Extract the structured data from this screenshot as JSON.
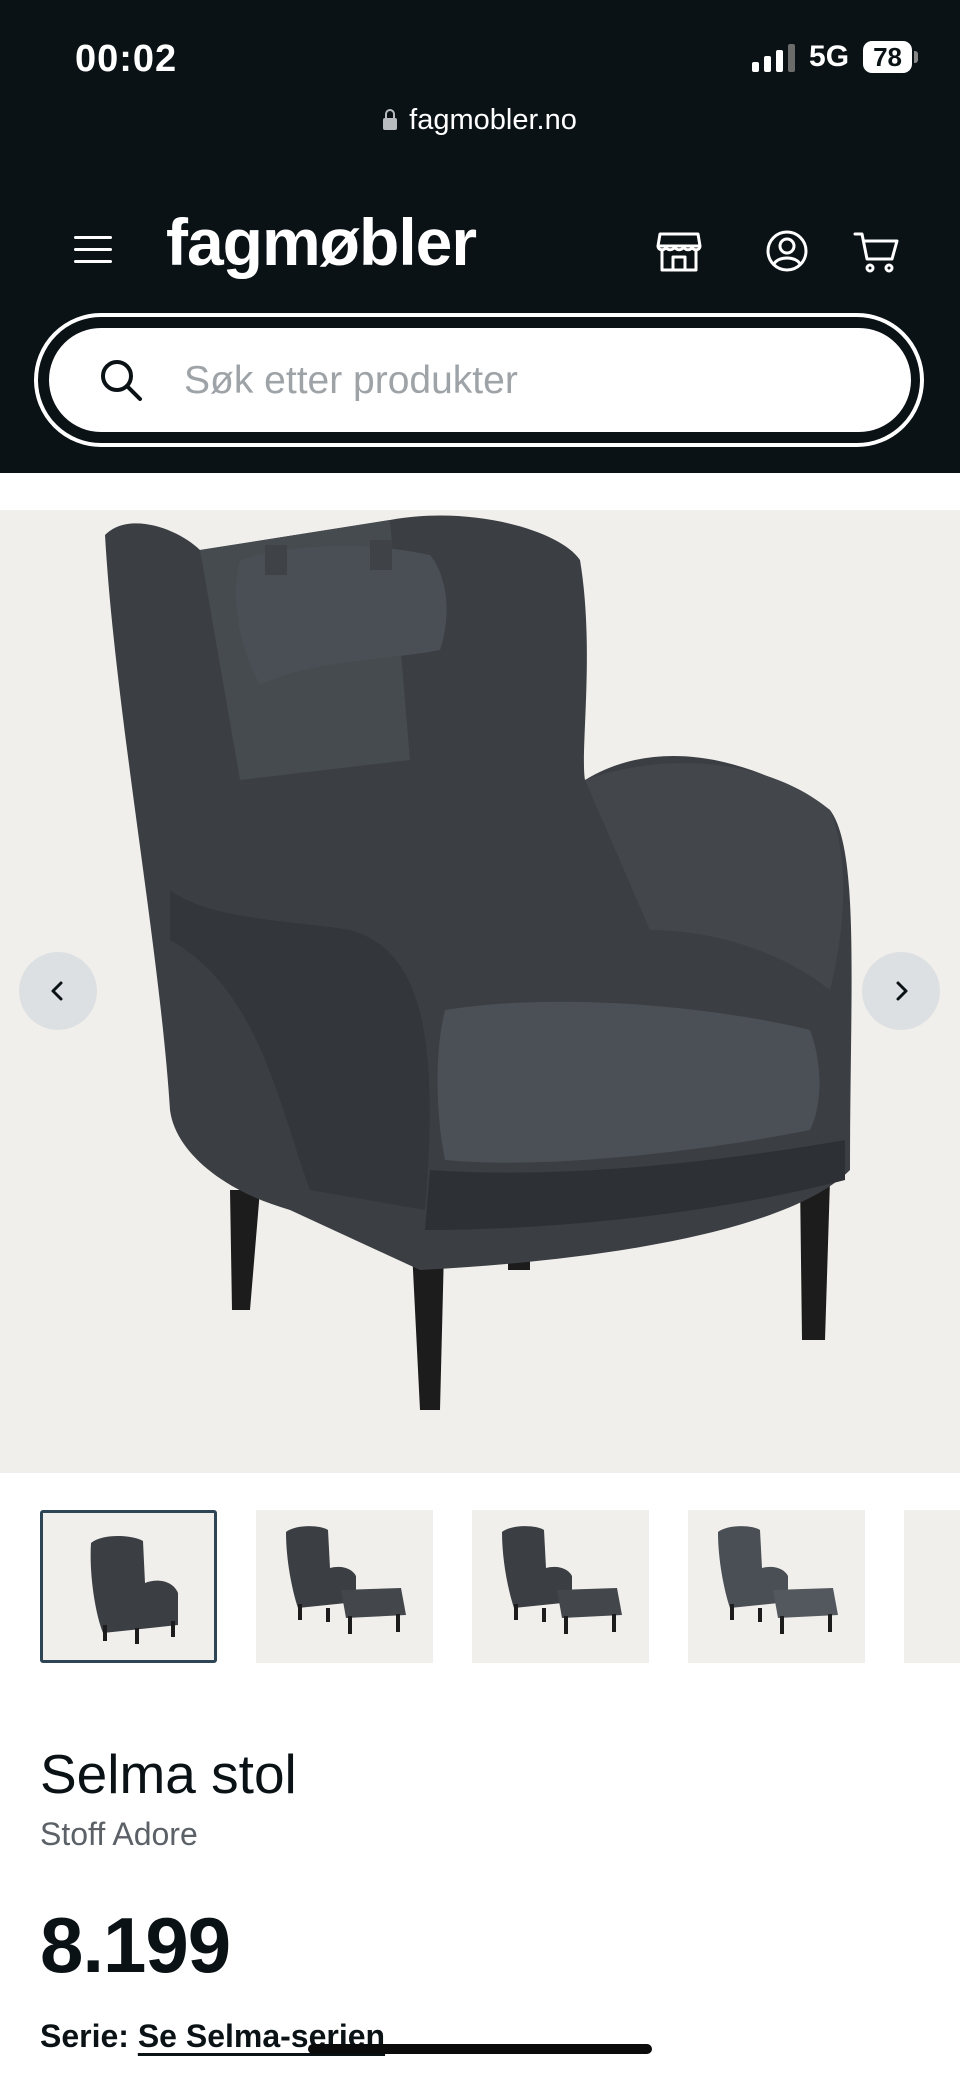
{
  "status_bar": {
    "time": "00:02",
    "network": "5G",
    "battery": "78"
  },
  "browser": {
    "url": "fagmobler.no"
  },
  "header": {
    "logo": "fagmøbler",
    "search_placeholder": "Søk etter produkter",
    "icons": [
      "menu-icon",
      "store-icon",
      "account-icon",
      "cart-icon"
    ]
  },
  "gallery": {
    "prev_icon": "chevron-left-icon",
    "next_icon": "chevron-right-icon",
    "thumbnails": [
      "chair",
      "chair-with-footstool",
      "chair-with-footstool",
      "chair-with-footstool"
    ]
  },
  "product": {
    "name": "Selma stol",
    "variant": "Stoff Adore",
    "price": "8.199",
    "series_label": "Serie:",
    "series_link": "Se Selma-serien"
  },
  "colors": {
    "header_bg": "#0b1216",
    "image_bg": "#f1efec",
    "active_thumb_border": "#2e4555"
  }
}
